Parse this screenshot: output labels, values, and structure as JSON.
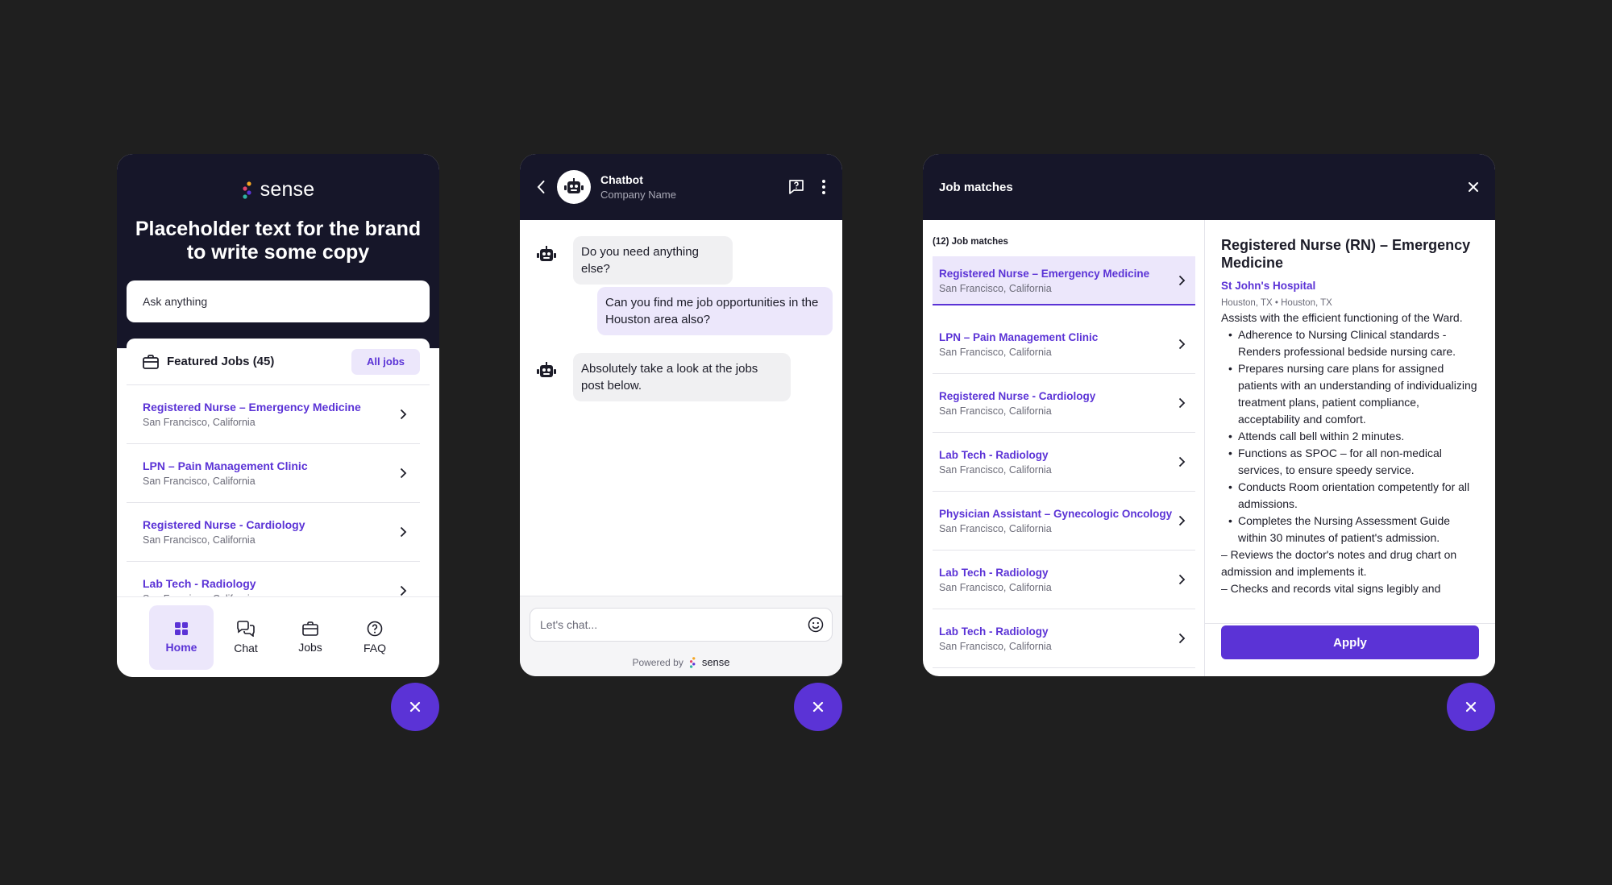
{
  "brand": {
    "name": "sense",
    "accent": "#5b33d6",
    "dark": "#161629",
    "dot_colors": [
      "#f5a623",
      "#e0446b",
      "#5b33d6",
      "#2fb3a3"
    ]
  },
  "home_widget": {
    "hero_title": "Placeholder text for the brand to write some copy",
    "ask_placeholder": "Ask anything",
    "featured_title": "Featured Jobs (45)",
    "all_jobs_label": "All jobs",
    "jobs": [
      {
        "title": "Registered Nurse – Emergency Medicine",
        "location": "San Francisco, California"
      },
      {
        "title": "LPN – Pain Management Clinic",
        "location": "San Francisco, California"
      },
      {
        "title": "Registered Nurse - Cardiology",
        "location": "San Francisco, California"
      },
      {
        "title": "Lab Tech - Radiology",
        "location": "San Francisco, California"
      }
    ],
    "nav": [
      {
        "label": "Home",
        "icon": "grid-icon",
        "active": true
      },
      {
        "label": "Chat",
        "icon": "chat-bubbles-icon",
        "active": false
      },
      {
        "label": "Jobs",
        "icon": "briefcase-icon",
        "active": false
      },
      {
        "label": "FAQ",
        "icon": "question-circle-icon",
        "active": false
      }
    ]
  },
  "chat_widget": {
    "bot_name": "Chatbot",
    "company_name": "Company Name",
    "messages": [
      {
        "from": "bot",
        "text": "Do you need anything else?"
      },
      {
        "from": "user",
        "text": "Can you find me job opportunities in the Houston area also?"
      },
      {
        "from": "bot",
        "text": "Absolutely take a look at the jobs post below."
      }
    ],
    "input_placeholder": "Let's chat...",
    "powered_by": "Powered by"
  },
  "matches_widget": {
    "title": "Job matches",
    "count_label": "(12) Job matches",
    "jobs": [
      {
        "title": "Registered Nurse – Emergency Medicine",
        "location": "San Francisco, California",
        "selected": true
      },
      {
        "title": "LPN – Pain Management Clinic",
        "location": "San Francisco, California"
      },
      {
        "title": "Registered Nurse - Cardiology",
        "location": "San Francisco, California"
      },
      {
        "title": "Lab Tech - Radiology",
        "location": "San Francisco, California"
      },
      {
        "title": "Physician Assistant – Gynecologic Oncology",
        "location": "San Francisco, California"
      },
      {
        "title": "Lab Tech - Radiology",
        "location": "San Francisco, California"
      },
      {
        "title": "Lab Tech - Radiology",
        "location": "San Francisco, California"
      }
    ],
    "detail": {
      "title": "Registered Nurse (RN) – Emergency Medicine",
      "company": "St John's Hospital",
      "meta": "Houston, TX  •  Houston, TX",
      "intro": "Assists with the efficient functioning of the Ward.",
      "bullets": [
        "Adherence to Nursing Clinical standards - Renders professional bedside nursing care.",
        "Prepares nursing care plans for assigned patients with an understanding of individualizing treatment plans, patient compliance, acceptability and comfort.",
        "Attends call bell within 2 minutes.",
        "Functions as SPOC – for all non-medical services, to ensure speedy service.",
        "Conducts Room orientation competently for all admissions.",
        "Completes the Nursing Assessment Guide within 30 minutes of patient's admission."
      ],
      "para1": "– Reviews the doctor's notes and drug chart on admission and implements it.",
      "para2": "– Checks and records vital signs legibly and",
      "apply_label": "Apply"
    }
  }
}
